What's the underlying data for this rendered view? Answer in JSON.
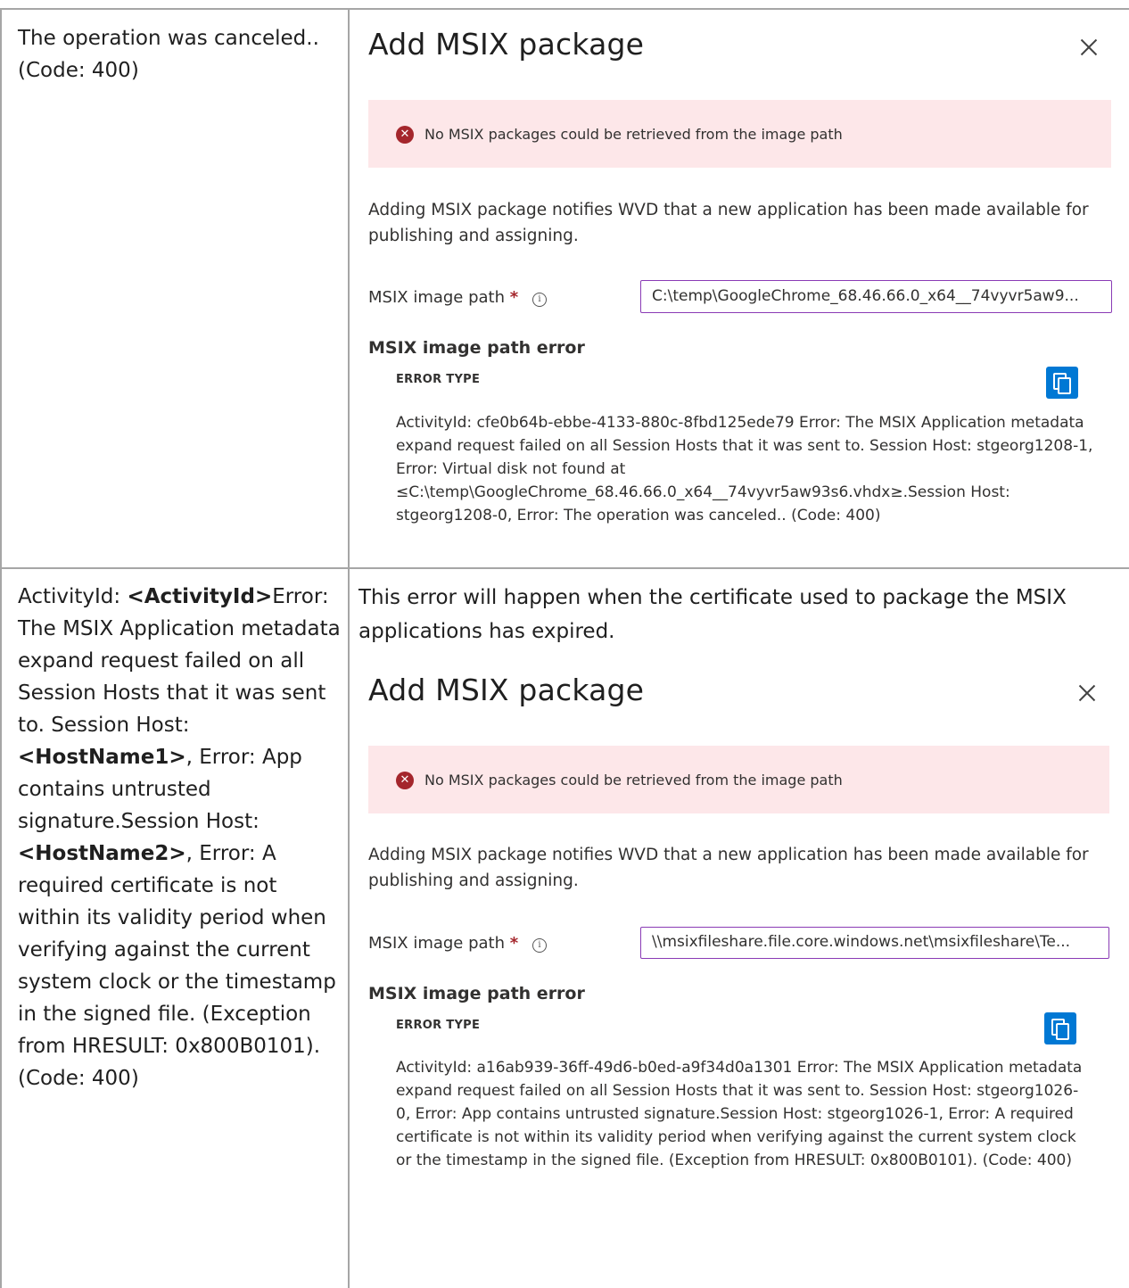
{
  "row1": {
    "left_text": "The operation was canceled.. (Code: 400)",
    "panel": {
      "title": "Add MSIX package",
      "banner_text": "No MSIX packages could be retrieved from the image path",
      "description": "Adding MSIX package notifies WVD that a new application has been made available for publishing and assigning.",
      "field_label": "MSIX image path",
      "required_mark": "*",
      "info_glyph": "i",
      "path_value": "C:\\temp\\GoogleChrome_68.46.66.0_x64__74vyvr5aw9...",
      "check_glyph": "✓",
      "section_heading": "MSIX image path error",
      "error_type_label": "ERROR TYPE",
      "error_body": "ActivityId: cfe0b64b-ebbe-4133-880c-8fbd125ede79 Error: The MSIX Application metadata expand request failed on all Session Hosts that it was sent to. Session Host: stgeorg1208-1, Error: Virtual disk not found at ≤C:\\temp\\GoogleChrome_68.46.66.0_x64__74vyvr5aw93s6.vhdx≥.Session Host: stgeorg1208-0, Error: The operation was canceled.. (Code: 400)"
    }
  },
  "row2": {
    "left": {
      "p1": "ActivityId: ",
      "b1": "<ActivityId>",
      "p2": "Error: The MSIX Application metadata expand request failed on all Session Hosts that it was sent to. Session Host: ",
      "b2": "<HostName1>",
      "p3": ", Error: App contains untrusted signature.Session Host: ",
      "b3": "<HostName2>",
      "p4": ", Error: A required certificate is not within its validity period when verifying against the current system clock or the timestamp in the signed file. (Exception from HRESULT: 0x800B0101). (Code: 400)"
    },
    "intro": "This error will happen when the certificate used to package the MSIX applications has expired.",
    "panel": {
      "title": "Add MSIX package",
      "banner_text": "No MSIX packages could be retrieved from the image path",
      "description": "Adding MSIX package notifies WVD that a new application has been made available for publishing and assigning.",
      "field_label": "MSIX image path",
      "required_mark": "*",
      "info_glyph": "i",
      "path_value": "\\\\msixfileshare.file.core.windows.net\\msixfileshare\\Te...",
      "check_glyph": "✓",
      "section_heading": "MSIX image path error",
      "error_type_label": "ERROR TYPE",
      "error_body": "ActivityId: a16ab939-36ff-49d6-b0ed-a9f34d0a1301 Error: The MSIX Application metadata expand request failed on all Session Hosts that it was sent to. Session Host: stgeorg1026-0, Error: App contains untrusted signature.Session Host: stgeorg1026-1, Error: A required certificate is not within its validity period when verifying against the current system clock or the timestamp in the signed file. (Exception from HRESULT: 0x800B0101). (Code: 400)"
    }
  },
  "colors": {
    "border": "#a6a6a6",
    "banner_bg": "#fde7e9",
    "error_red": "#a4262c",
    "input_border": "#8a3bb5",
    "success_green": "#107c10",
    "primary_blue": "#0078d4"
  },
  "icons": {
    "banner": "error-circle-icon",
    "close": "close-icon",
    "info": "info-icon",
    "valid": "checkmark-icon",
    "copy": "copy-icon"
  }
}
